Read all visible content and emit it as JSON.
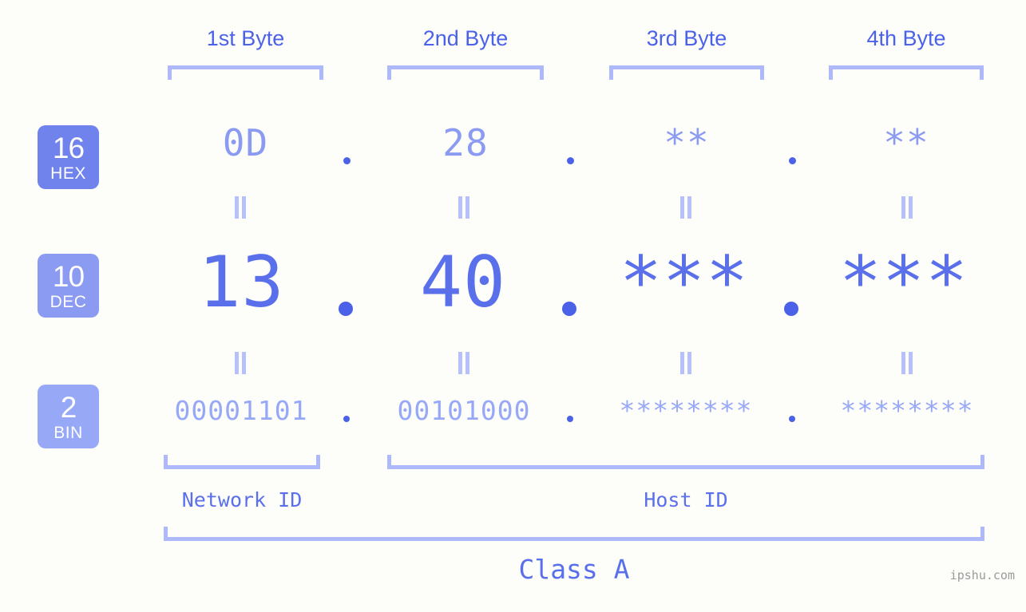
{
  "background_color": "#fdfdfa",
  "accent_colors": {
    "strong_blue": "#4b62e8",
    "mid_blue": "#5a70ea",
    "light_blue": "#8b9bf2",
    "pale_blue": "#97a8f6",
    "bracket_blue": "#aeb9fb",
    "watermark_gray": "#9a9a9a"
  },
  "byte_headers": [
    {
      "label": "1st Byte"
    },
    {
      "label": "2nd Byte"
    },
    {
      "label": "3rd Byte"
    },
    {
      "label": "4th Byte"
    }
  ],
  "radix_badges": [
    {
      "number": "16",
      "system": "HEX",
      "color": "#7083ec"
    },
    {
      "number": "10",
      "system": "DEC",
      "color": "#8b9bf2"
    },
    {
      "number": "2",
      "system": "BIN",
      "color": "#97a8f6"
    }
  ],
  "rows": {
    "hex": {
      "radix": "16",
      "system": "HEX",
      "values": [
        "0D",
        "28",
        "**",
        "**"
      ],
      "separator": "."
    },
    "dec": {
      "radix": "10",
      "system": "DEC",
      "values": [
        "13",
        "40",
        "***",
        "***"
      ],
      "separator": "."
    },
    "bin": {
      "radix": "2",
      "system": "BIN",
      "values": [
        "00001101",
        "00101000",
        "********",
        "********"
      ],
      "separator": "."
    }
  },
  "equality_marker": "=",
  "sections": {
    "network_id": "Network ID",
    "host_id": "Host ID",
    "class": "Class A"
  },
  "watermark": "ipshu.com"
}
